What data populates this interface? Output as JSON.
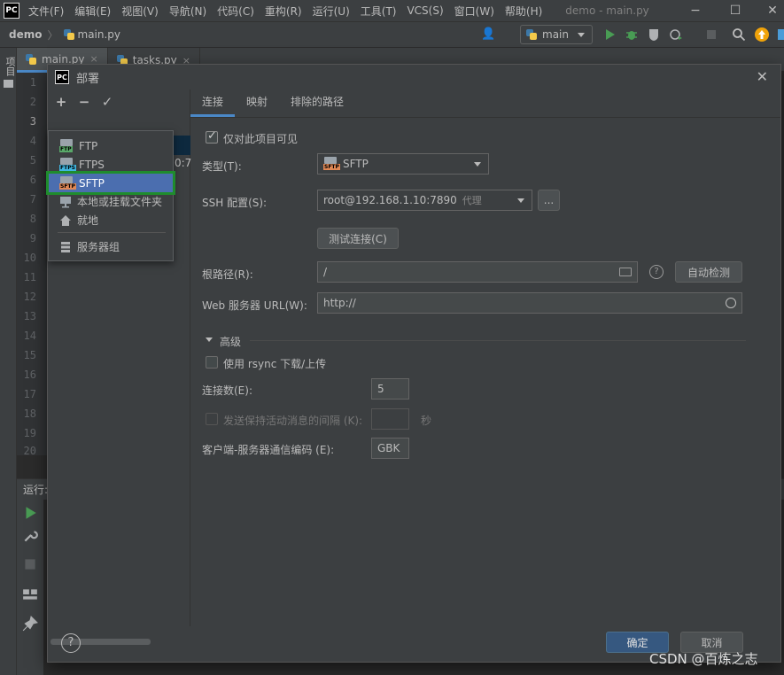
{
  "menubar": {
    "logo": "PC",
    "items": [
      "文件(F)",
      "编辑(E)",
      "视图(V)",
      "导航(N)",
      "代码(C)",
      "重构(R)",
      "运行(U)",
      "工具(T)",
      "VCS(S)",
      "窗口(W)",
      "帮助(H)"
    ],
    "window_title": "demo - main.py"
  },
  "navbar": {
    "project": "demo",
    "file": "main.py",
    "run_config": "main"
  },
  "left_strip_label": "项目",
  "editor": {
    "tabs": [
      {
        "label": "main.py",
        "close": "×"
      },
      {
        "label": "tasks.py",
        "close": "×"
      }
    ],
    "line_numbers": [
      "1",
      "2",
      "3",
      "4",
      "5",
      "6",
      "7",
      "8",
      "9",
      "10",
      "11",
      "12",
      "13",
      "14",
      "15",
      "16",
      "17",
      "18",
      "19",
      "20"
    ],
    "current_line": "3"
  },
  "run_panel": {
    "label": "运行:"
  },
  "dialog": {
    "logo": "PC",
    "title": "部署",
    "close": "✕",
    "toolbar": {
      "add": "+",
      "remove": "−",
      "apply": "✓"
    },
    "server_row_fragment": "0:7",
    "add_menu": [
      {
        "label": "FTP",
        "icon": "ftp-icon",
        "tag": "FTP"
      },
      {
        "label": "FTPS",
        "icon": "ftps-icon",
        "tag": "FTPS"
      },
      {
        "label": "SFTP",
        "icon": "sftp-icon",
        "tag": "SFTP"
      },
      {
        "label": "本地或挂载文件夹",
        "icon": "mounted-folder-icon"
      },
      {
        "label": "就地",
        "icon": "home-icon"
      },
      {
        "label": "服务器组",
        "icon": "server-group-icon"
      }
    ],
    "tabs": [
      "连接",
      "映射",
      "排除的路径"
    ],
    "active_tab": "连接",
    "visible_only_for_project": {
      "label": "仅对此项目可见",
      "checked": true
    },
    "type": {
      "label": "类型(T):",
      "value": "SFTP",
      "tag": "SFTP"
    },
    "ssh_config": {
      "label": "SSH 配置(S):",
      "value": "root@192.168.1.10:7890",
      "suffix": "代理",
      "more_button": "..."
    },
    "test_connection_button": "测试连接(C)",
    "root_path": {
      "label": "根路径(R):",
      "value": "/",
      "autodetect_button": "自动检测",
      "help": "?"
    },
    "web_server_url": {
      "label": "Web 服务器 URL(W):",
      "value": "http://"
    },
    "advanced": {
      "section_title": "高级",
      "use_rsync": {
        "label": "使用 rsync 下载/上传",
        "checked": false
      },
      "connections": {
        "label": "连接数(E):",
        "value": "5"
      },
      "keepalive": {
        "label": "发送保持活动消息的间隔 (K):",
        "value": "",
        "unit": "秒",
        "checked": false,
        "enabled": false
      },
      "encoding": {
        "label": "客户端-服务器通信编码 (E):",
        "value": "GBK"
      }
    },
    "help_button": "?",
    "ok_button": "确定",
    "cancel_button": "取消"
  },
  "watermark": "CSDN @百炼之志"
}
